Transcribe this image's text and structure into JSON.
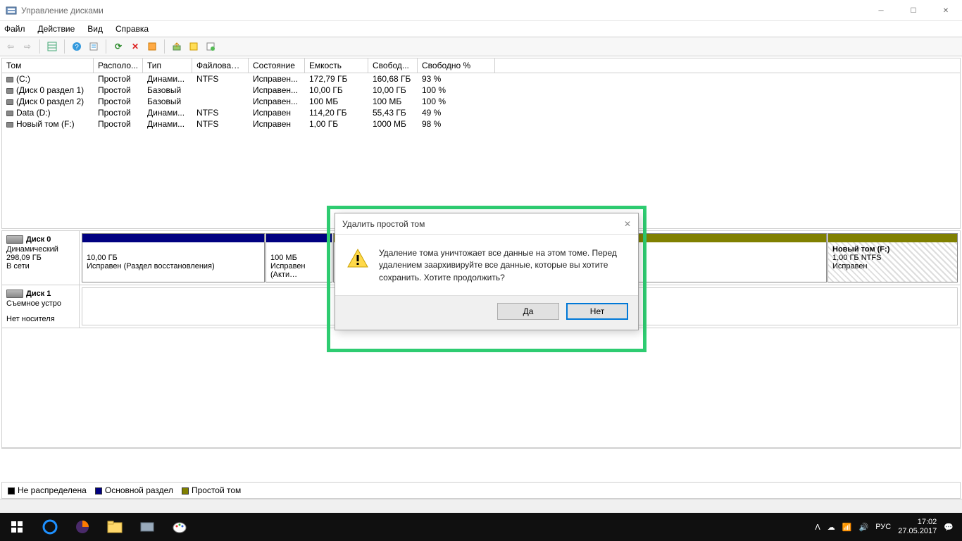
{
  "window": {
    "title": "Управление дисками"
  },
  "menu": {
    "file": "Файл",
    "action": "Действие",
    "view": "Вид",
    "help": "Справка"
  },
  "columns": {
    "volume": "Том",
    "layout": "Располо...",
    "type": "Тип",
    "fs": "Файловая с...",
    "status": "Состояние",
    "capacity": "Емкость",
    "free": "Свобод...",
    "free_pct": "Свободно %"
  },
  "volumes": [
    {
      "name": "(C:)",
      "layout": "Простой",
      "type": "Динами...",
      "fs": "NTFS",
      "status": "Исправен...",
      "capacity": "172,79 ГБ",
      "free": "160,68 ГБ",
      "free_pct": "93 %"
    },
    {
      "name": "(Диск 0 раздел 1)",
      "layout": "Простой",
      "type": "Базовый",
      "fs": "",
      "status": "Исправен...",
      "capacity": "10,00 ГБ",
      "free": "10,00 ГБ",
      "free_pct": "100 %"
    },
    {
      "name": "(Диск 0 раздел 2)",
      "layout": "Простой",
      "type": "Базовый",
      "fs": "",
      "status": "Исправен...",
      "capacity": "100 МБ",
      "free": "100 МБ",
      "free_pct": "100 %"
    },
    {
      "name": "Data (D:)",
      "layout": "Простой",
      "type": "Динами...",
      "fs": "NTFS",
      "status": "Исправен",
      "capacity": "114,20 ГБ",
      "free": "55,43 ГБ",
      "free_pct": "49 %"
    },
    {
      "name": "Новый том (F:)",
      "layout": "Простой",
      "type": "Динами...",
      "fs": "NTFS",
      "status": "Исправен",
      "capacity": "1,00 ГБ",
      "free": "1000 МБ",
      "free_pct": "98 %"
    }
  ],
  "disk0": {
    "name": "Диск 0",
    "type": "Динамический",
    "size": "298,09 ГБ",
    "status": "В сети",
    "parts": {
      "p1_size": "10,00 ГБ",
      "p1_status": "Исправен (Раздел восстановления)",
      "p2_size": "100 МБ",
      "p2_status": "Исправен (Акти…",
      "p5_name": "Новый том  (F:)",
      "p5_size": "1,00 ГБ NTFS",
      "p5_status": "Исправен"
    }
  },
  "disk1": {
    "name": "Диск 1",
    "type": "Съемное устро",
    "status": "Нет носителя"
  },
  "legend": {
    "unalloc": "Не распределена",
    "primary": "Основной раздел",
    "simple": "Простой том"
  },
  "dialog": {
    "title": "Удалить простой том",
    "message": "Удаление тома уничтожает все данные на этом томе. Перед удалением заархивируйте все данные, которые вы хотите сохранить. Хотите продолжить?",
    "yes": "Да",
    "no": "Нет"
  },
  "taskbar": {
    "lang": "РУС",
    "time": "17:02",
    "date": "27.05.2017"
  }
}
